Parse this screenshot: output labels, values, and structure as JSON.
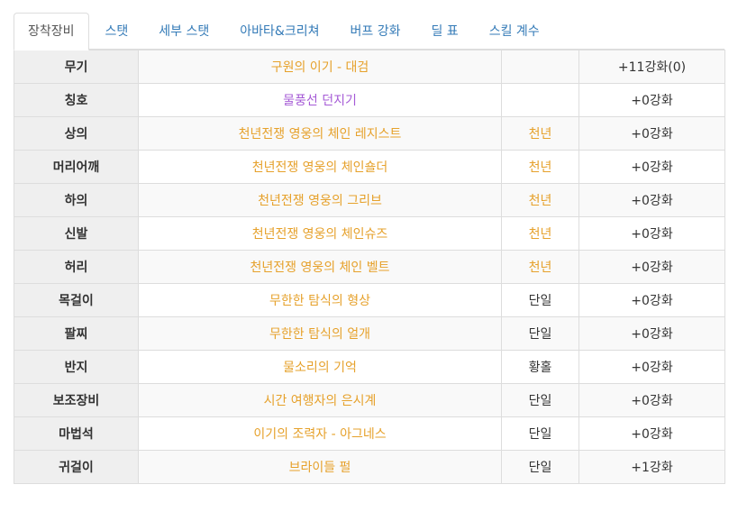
{
  "tabs": [
    {
      "label": "장착장비",
      "active": true
    },
    {
      "label": "스탯",
      "active": false
    },
    {
      "label": "세부 스탯",
      "active": false
    },
    {
      "label": "아바타&크리쳐",
      "active": false
    },
    {
      "label": "버프 강화",
      "active": false
    },
    {
      "label": "딜 표",
      "active": false
    },
    {
      "label": "스킬 계수",
      "active": false
    }
  ],
  "equipment": [
    {
      "slot": "무기",
      "item": "구원의 이기 - 대검",
      "set": "",
      "enhance": "+11강화(0)",
      "item_color": "#e6a12b"
    },
    {
      "slot": "칭호",
      "item": "물풍선 던지기",
      "set": "",
      "enhance": "+0강화",
      "item_color": "#a55ad6"
    },
    {
      "slot": "상의",
      "item": "천년전쟁 영웅의 체인 레지스트",
      "set": "천년",
      "enhance": "+0강화",
      "item_color": "#e6a12b"
    },
    {
      "slot": "머리어깨",
      "item": "천년전쟁 영웅의 체인숄더",
      "set": "천년",
      "enhance": "+0강화",
      "item_color": "#e6a12b"
    },
    {
      "slot": "하의",
      "item": "천년전쟁 영웅의 그리브",
      "set": "천년",
      "enhance": "+0강화",
      "item_color": "#e6a12b"
    },
    {
      "slot": "신발",
      "item": "천년전쟁 영웅의 체인슈즈",
      "set": "천년",
      "enhance": "+0강화",
      "item_color": "#e6a12b"
    },
    {
      "slot": "허리",
      "item": "천년전쟁 영웅의 체인 벨트",
      "set": "천년",
      "enhance": "+0강화",
      "item_color": "#e6a12b"
    },
    {
      "slot": "목걸이",
      "item": "무한한 탐식의 형상",
      "set": "단일",
      "enhance": "+0강화",
      "item_color": "#e6a12b"
    },
    {
      "slot": "팔찌",
      "item": "무한한 탐식의 얼개",
      "set": "단일",
      "enhance": "+0강화",
      "item_color": "#e6a12b"
    },
    {
      "slot": "반지",
      "item": "물소리의 기억",
      "set": "황홀",
      "enhance": "+0강화",
      "item_color": "#e6a12b"
    },
    {
      "slot": "보조장비",
      "item": "시간 여행자의 은시계",
      "set": "단일",
      "enhance": "+0강화",
      "item_color": "#e6a12b"
    },
    {
      "slot": "마법석",
      "item": "이기의 조력자 - 아그네스",
      "set": "단일",
      "enhance": "+0강화",
      "item_color": "#e6a12b"
    },
    {
      "slot": "귀걸이",
      "item": "브라이들 펄",
      "set": "단일",
      "enhance": "+1강화",
      "item_color": "#e6a12b"
    }
  ],
  "colors": {
    "link": "#337ab7",
    "legendary": "#e6a12b",
    "rare_title": "#a55ad6",
    "border": "#dddddd"
  }
}
